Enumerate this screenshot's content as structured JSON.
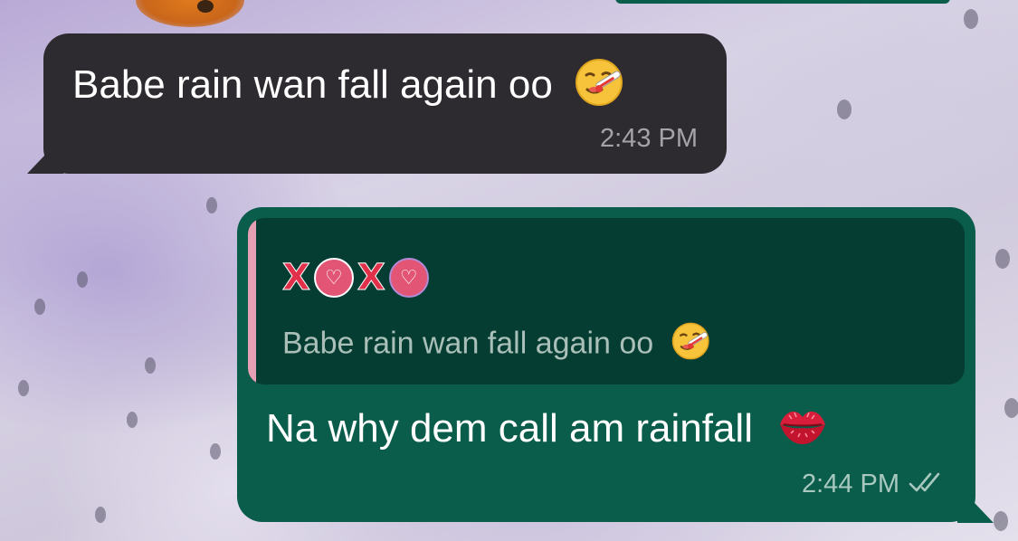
{
  "colors": {
    "incoming_bubble": "#2d2b30",
    "outgoing_bubble": "#0a5c4b",
    "quote_background": "#053d32",
    "quote_bar": "#e5a1b3",
    "timestamp_text": "#a5a3a8",
    "read_ticks": "#a9c8bf"
  },
  "messages": [
    {
      "direction": "incoming",
      "text": "Babe rain wan fall again oo",
      "emoji": "face-with-thermometer-icon",
      "time": "2:43 PM"
    },
    {
      "direction": "outgoing",
      "reply_to": {
        "author": {
          "x1": "X",
          "x2": "X",
          "o_icon": "heart-icon"
        },
        "text": "Babe rain wan fall again oo",
        "emoji": "face-with-thermometer-icon"
      },
      "text": "Na why dem call am rainfall",
      "emoji": "kiss-mark-icon",
      "time": "2:44 PM",
      "status_icon": "double-check-icon"
    }
  ]
}
